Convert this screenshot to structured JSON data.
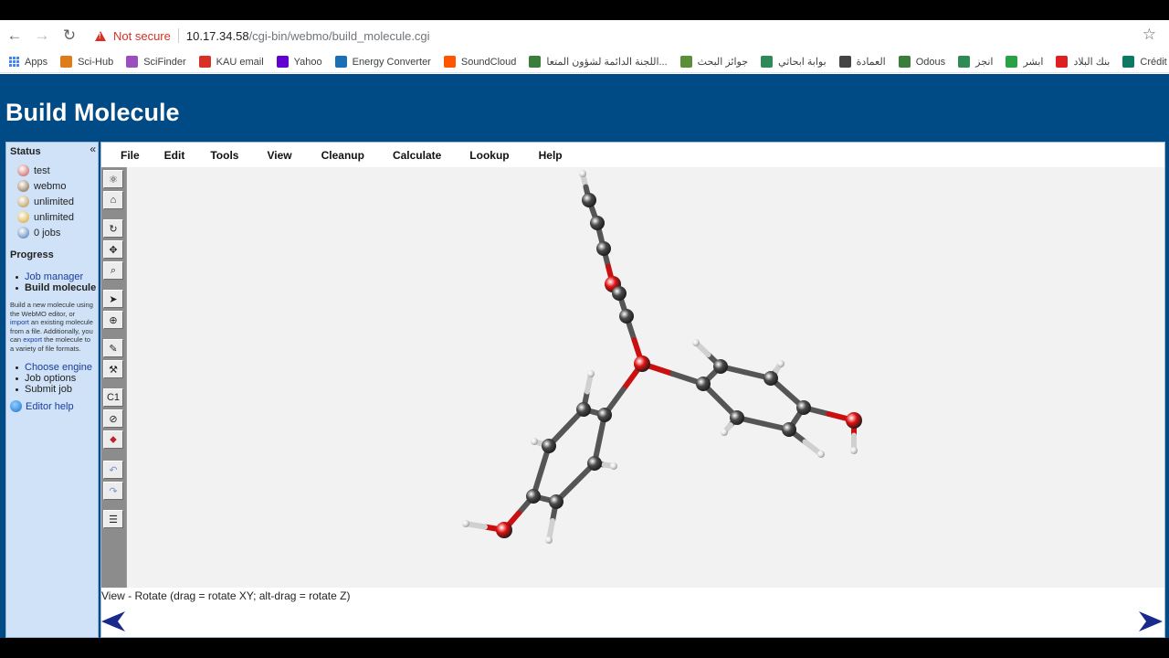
{
  "browser": {
    "security_label": "Not secure",
    "url_host": "10.17.34.58",
    "url_path": "/cgi-bin/webmo/build_molecule.cgi",
    "bookmarks": [
      {
        "label": "Apps",
        "color": "#4285f4"
      },
      {
        "label": "Sci-Hub",
        "color": "#e07b1a"
      },
      {
        "label": "SciFinder",
        "color": "#9b4fbf"
      },
      {
        "label": "KAU email",
        "color": "#d93025"
      },
      {
        "label": "Yahoo",
        "color": "#6001d2"
      },
      {
        "label": "Energy Converter",
        "color": "#1c6fb5"
      },
      {
        "label": "SoundCloud",
        "color": "#ff5500"
      },
      {
        "label": "اللجنة الدائمة لشؤون المتعا...",
        "color": "#3b7d3b"
      },
      {
        "label": "جوائز البحث",
        "color": "#5a8f3a"
      },
      {
        "label": "بوابة ابحاثي",
        "color": "#2e8b57"
      },
      {
        "label": "العمادة",
        "color": "#444444"
      },
      {
        "label": "Odous",
        "color": "#3b7d3b"
      },
      {
        "label": "انجز",
        "color": "#2e8b57"
      },
      {
        "label": "ابشر",
        "color": "#27a345"
      },
      {
        "label": "بنك البلاد",
        "color": "#e02020"
      },
      {
        "label": "Crédit Agricole",
        "color": "#0a7a63"
      }
    ]
  },
  "page": {
    "title": "Build Molecule"
  },
  "sidebar": {
    "status_heading": "Status",
    "status_items": [
      {
        "label": "test",
        "icon": "user-icon"
      },
      {
        "label": "webmo",
        "icon": "group-icon"
      },
      {
        "label": "unlimited",
        "icon": "time-limit-icon"
      },
      {
        "label": "unlimited",
        "icon": "clock-icon"
      },
      {
        "label": "0 jobs",
        "icon": "jobs-icon"
      }
    ],
    "progress_heading": "Progress",
    "progress_items": [
      {
        "label": "Job manager",
        "link": true
      },
      {
        "label": "Build molecule",
        "link": false
      }
    ],
    "description": {
      "part1": "Build a new molecule using the WebMO editor, or ",
      "import_link": "import",
      "part2": " an existing molecule from a file. Additionally, you can ",
      "export_link": "export",
      "part3": " the molecule to a variety of file formats."
    },
    "next_items": [
      {
        "label": "Choose engine",
        "link": true
      },
      {
        "label": "Job options",
        "link": false
      },
      {
        "label": "Submit job",
        "link": false
      }
    ],
    "editor_help": "Editor help"
  },
  "editor": {
    "menu": [
      "File",
      "Edit",
      "Tools",
      "View",
      "Cleanup",
      "Calculate",
      "Lookup",
      "Help"
    ],
    "status_text": "View - Rotate (drag = rotate XY; alt-drag = rotate Z)",
    "tools": [
      {
        "name": "draw-atoms-tool",
        "glyph": "⚛"
      },
      {
        "name": "fragment-tool",
        "glyph": "⌂"
      },
      {
        "name": "rotate-tool",
        "glyph": "↻"
      },
      {
        "name": "translate-tool",
        "glyph": "✥"
      },
      {
        "name": "zoom-tool",
        "glyph": "⌕"
      },
      {
        "name": "select-tool",
        "glyph": "➤"
      },
      {
        "name": "adjust-tool",
        "glyph": "⊕"
      },
      {
        "name": "clean-tool",
        "glyph": "✎"
      },
      {
        "name": "build-tool",
        "glyph": "⚒"
      },
      {
        "name": "symmetry-tool",
        "glyph": "C1"
      },
      {
        "name": "symmetrize-tool",
        "glyph": "⊘"
      },
      {
        "name": "comprehensive-tool",
        "glyph": "⬥"
      },
      {
        "name": "undo-tool",
        "glyph": "↶"
      },
      {
        "name": "redo-tool",
        "glyph": "↷"
      },
      {
        "name": "list-tool",
        "glyph": "☰"
      }
    ]
  },
  "colors": {
    "header_bg": "#004a85",
    "sidebar_bg": "#cfe2f7",
    "carbon": "#4a4a4a",
    "oxygen": "#e01010",
    "hydrogen": "#e8e8e8",
    "arrow": "#1a2a8c"
  }
}
